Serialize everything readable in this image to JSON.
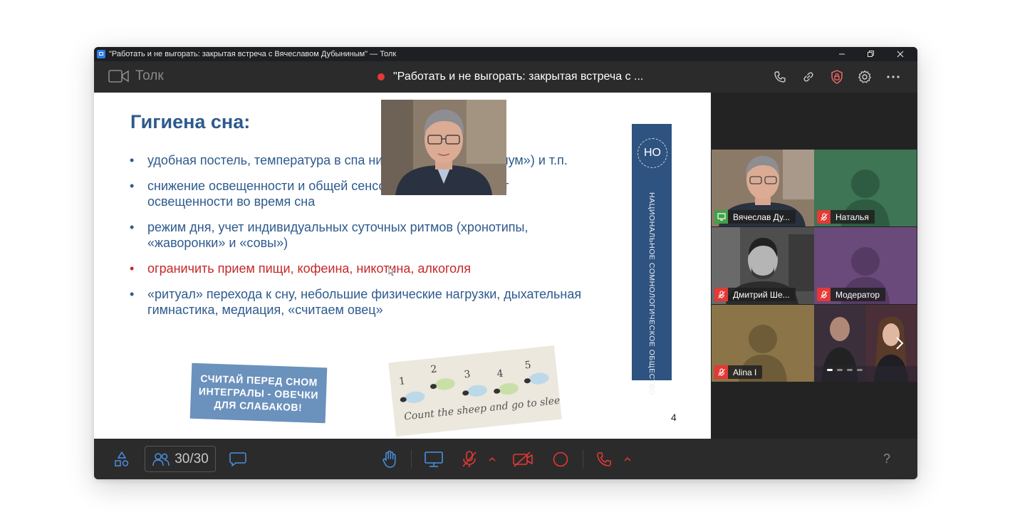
{
  "window": {
    "title": "\"Работать и не выгорать: закрытая встреча с Вячеславом Дубыниным\" — Толк",
    "controls": [
      "minimize-icon",
      "maximize-icon",
      "close-icon"
    ]
  },
  "app": {
    "name": "Толк",
    "meeting_title": "\"Работать и не выгорать: закрытая встреча с ...",
    "recording_color": "#e53935",
    "top_icons": [
      "phone-icon",
      "link-icon",
      "shield-lock-icon",
      "gear-icon",
      "more-icon"
    ]
  },
  "slide": {
    "title": "Гигиена сна:",
    "bullets": [
      {
        "text": "удобная постель, температура в спа                          ние, тишина («белый шум») и т.п.",
        "color": "blue"
      },
      {
        "text": "снижение освещенности и общей сенсорной нагрузки + учет освещенности во время сна",
        "color": "blue"
      },
      {
        "text": "режим дня, учет индивидуальных суточных ритмов   (хронотипы, «жаворонки» и «совы»)",
        "color": "blue"
      },
      {
        "text": "ограничить прием пищи, кофеина, никотина, алкоголя",
        "color": "red"
      },
      {
        "text": "«ритуал» перехода к сну, небольшие физические нагрузки, дыхательная гимнастика, медиация, «считаем овец»",
        "color": "blue"
      }
    ],
    "sticker_text": "считай перед сном\nинтегралы - овечки\nдля слабаков!",
    "sheep_numbers": [
      "1",
      "2",
      "3",
      "4",
      "5"
    ],
    "sheep_caption": "Count the sheep and go to sleep...",
    "side_banner_text": "Национальное сомнологическое общество",
    "side_banner_logo": "НО",
    "page_number": "4"
  },
  "participants": [
    {
      "name": "Вячеслав Ду...",
      "status": "screen-share-icon",
      "status_color": "#43a047",
      "tile_color": "#8c7a68",
      "active": true,
      "video": true
    },
    {
      "name": "Наталья",
      "status": "mic-off-icon",
      "status_color": "#e53935",
      "tile_color": "#3d7555",
      "active": false,
      "video": false
    },
    {
      "name": "Дмитрий Ше...",
      "status": "mic-off-icon",
      "status_color": "#e53935",
      "tile_color": "#5a5a5a",
      "active": false,
      "video": true
    },
    {
      "name": "Модератор",
      "status": "mic-off-icon",
      "status_color": "#e53935",
      "tile_color": "#6a4a7a",
      "active": false,
      "video": false
    },
    {
      "name": "Alina I",
      "status": "mic-off-icon",
      "status_color": "#e53935",
      "tile_color": "#8a7448",
      "active": false,
      "video": false
    }
  ],
  "toolbar": {
    "participants_count": "30/30",
    "help": "?",
    "accent_red": "#e53935",
    "accent_blue": "#4a90e2"
  }
}
